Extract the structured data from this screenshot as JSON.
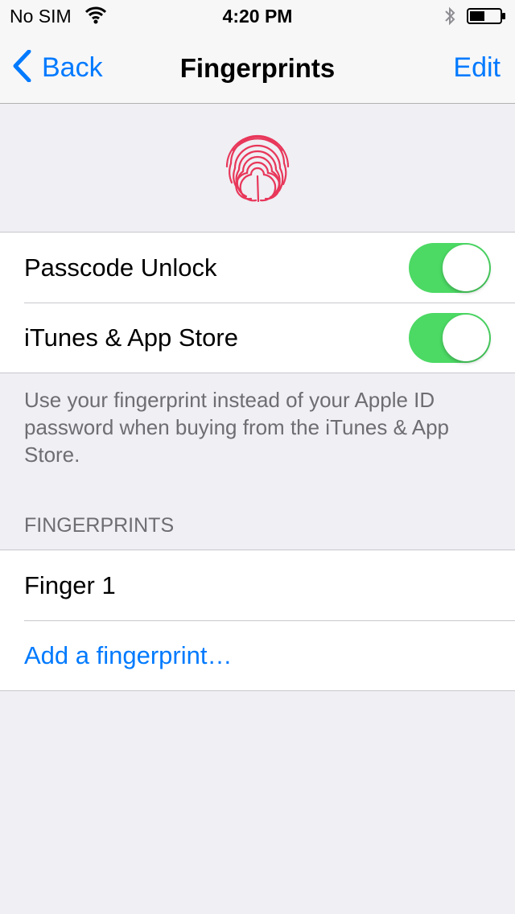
{
  "status_bar": {
    "carrier": "No SIM",
    "time": "4:20 PM",
    "icons": [
      "wifi-icon",
      "bluetooth-icon",
      "battery-icon"
    ]
  },
  "nav": {
    "back_label": "Back",
    "title": "Fingerprints",
    "edit_label": "Edit"
  },
  "header_icon": "fingerprint-icon",
  "settings": {
    "rows": [
      {
        "label": "Passcode Unlock",
        "on": true
      },
      {
        "label": "iTunes & App Store",
        "on": true
      }
    ],
    "footer": "Use your fingerprint instead of your Apple ID password when buying from the iTunes & App Store."
  },
  "fingerprints": {
    "header": "FINGERPRINTS",
    "items": [
      {
        "label": "Finger 1"
      }
    ],
    "add_label": "Add a fingerprint…"
  },
  "colors": {
    "accent": "#007aff",
    "toggle_on": "#4cd964",
    "fingerprint": "#e8375a",
    "background": "#efeff4"
  }
}
